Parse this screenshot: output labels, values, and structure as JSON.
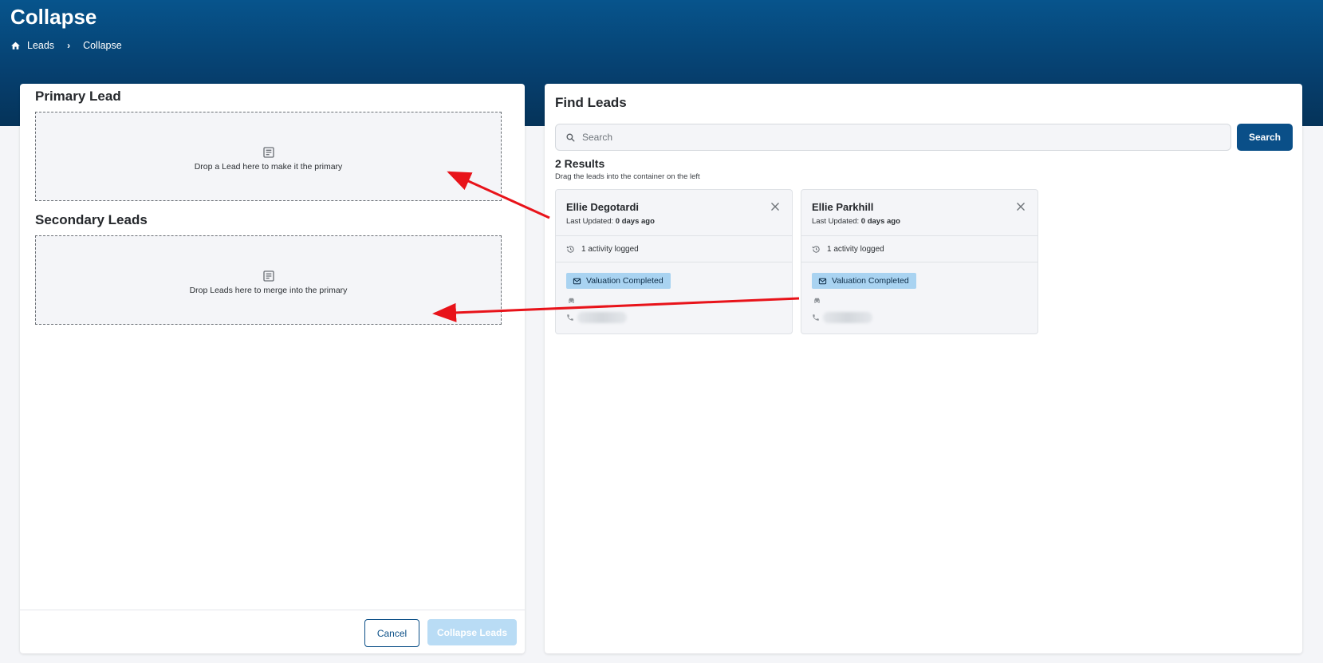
{
  "page": {
    "title": "Collapse",
    "breadcrumb": [
      "Leads",
      "Collapse"
    ]
  },
  "left_panel": {
    "primary_title": "Primary Lead",
    "primary_drop_text": "Drop a Lead here to make it the primary",
    "secondary_title": "Secondary Leads",
    "secondary_drop_text": "Drop Leads here to merge into the primary",
    "cancel_label": "Cancel",
    "collapse_label": "Collapse Leads"
  },
  "right_panel": {
    "title": "Find Leads",
    "search_placeholder": "Search",
    "search_button": "Search",
    "results_count": "2 Results",
    "results_hint": "Drag the leads into the container on the left",
    "leads": [
      {
        "name": "Ellie Degotardi",
        "updated_label": "Last Updated:",
        "updated_value": "0 days ago",
        "activity": "1 activity logged",
        "status": "Valuation Completed"
      },
      {
        "name": "Ellie Parkhill",
        "updated_label": "Last Updated:",
        "updated_value": "0 days ago",
        "activity": "1 activity logged",
        "status": "Valuation Completed"
      }
    ]
  },
  "colors": {
    "header": "#063f6e",
    "primary": "#0a4f88",
    "badge": "#a9d3f1",
    "disabled_button": "#b9dcf5",
    "annotation_arrow": "#e8131a"
  },
  "icons": [
    "home-icon",
    "chevron-right-icon",
    "note-icon",
    "search-icon",
    "close-icon",
    "history-icon",
    "mail-icon",
    "car-icon",
    "phone-icon"
  ]
}
